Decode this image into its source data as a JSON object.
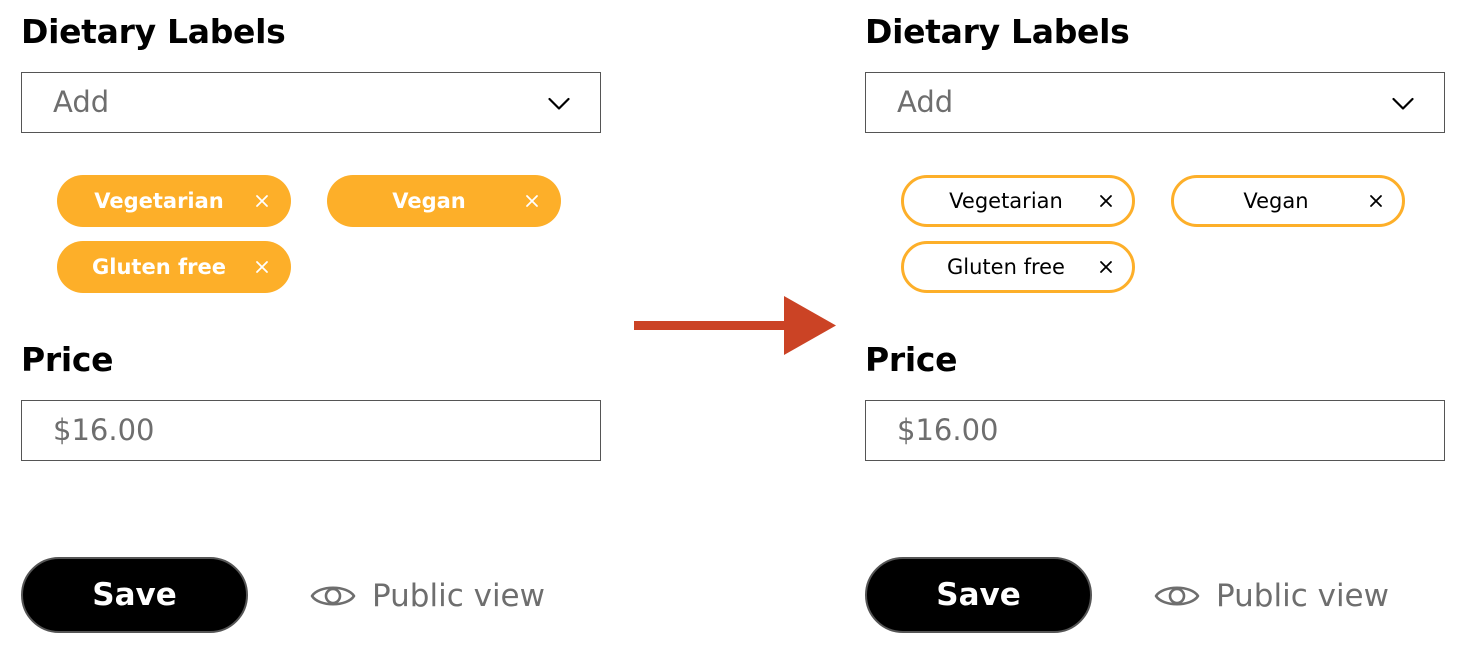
{
  "colors": {
    "chip_accent": "#FDAF29",
    "arrow": "#CB4325",
    "save_bg": "#000000",
    "placeholder_text": "#6E6E6E"
  },
  "before": {
    "dietary_title": "Dietary Labels",
    "dietary_select": {
      "placeholder": "Add",
      "icon": "chevron-down-icon"
    },
    "chips": [
      {
        "label": "Vegetarian",
        "remove_icon": "close-icon"
      },
      {
        "label": "Vegan",
        "remove_icon": "close-icon"
      },
      {
        "label": "Gluten free",
        "remove_icon": "close-icon"
      }
    ],
    "chip_style": "filled",
    "price_title": "Price",
    "price_value": "$16.00",
    "save_label": "Save",
    "public_view_label": "Public view",
    "public_view_icon": "eye-icon"
  },
  "transition_icon": "right-arrow-icon",
  "after": {
    "dietary_title": "Dietary Labels",
    "dietary_select": {
      "placeholder": "Add",
      "icon": "chevron-down-icon"
    },
    "chips": [
      {
        "label": "Vegetarian",
        "remove_icon": "close-icon"
      },
      {
        "label": "Vegan",
        "remove_icon": "close-icon"
      },
      {
        "label": "Gluten free",
        "remove_icon": "close-icon"
      }
    ],
    "chip_style": "outlined",
    "price_title": "Price",
    "price_value": "$16.00",
    "save_label": "Save",
    "public_view_label": "Public view",
    "public_view_icon": "eye-icon"
  }
}
